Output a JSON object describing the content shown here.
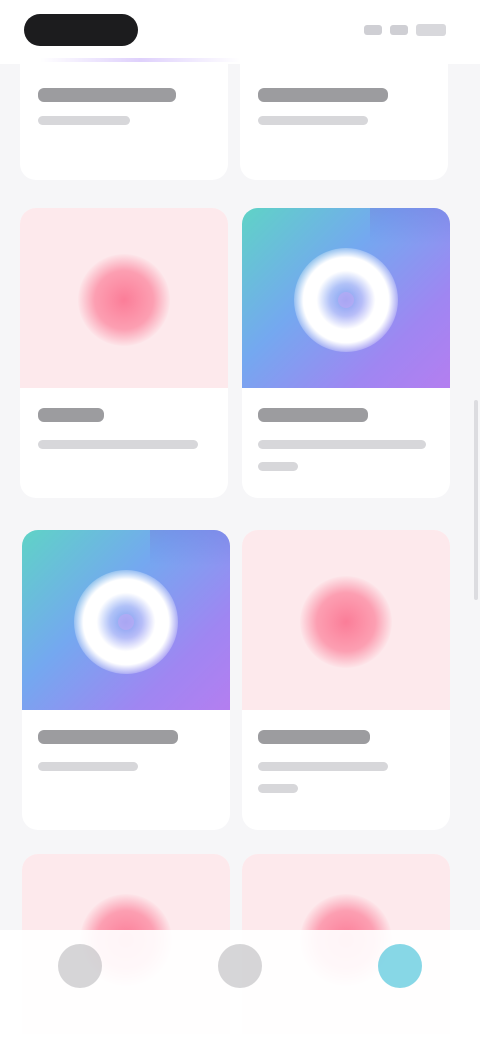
{
  "app": {
    "title": ""
  },
  "status_bar": {
    "time": ""
  },
  "cards": [
    {
      "kind": "text",
      "title": "",
      "subtitle": ""
    },
    {
      "kind": "text",
      "title": "",
      "subtitle": ""
    },
    {
      "kind": "pink",
      "title": "",
      "subtitle": "",
      "icon": "heart-icon"
    },
    {
      "kind": "gradient",
      "title": "",
      "subtitle": "",
      "icon": "record-icon"
    },
    {
      "kind": "gradient",
      "title": "",
      "subtitle": "",
      "icon": "record-icon"
    },
    {
      "kind": "pink",
      "title": "",
      "subtitle": "",
      "icon": "heart-icon"
    },
    {
      "kind": "pink",
      "title": "",
      "subtitle": "",
      "icon": "heart-icon"
    },
    {
      "kind": "pink",
      "title": "",
      "subtitle": "",
      "icon": "heart-icon"
    }
  ],
  "bottom_nav": {
    "items": [
      {
        "label": "",
        "icon": "home-icon"
      },
      {
        "label": "",
        "icon": "explore-icon"
      },
      {
        "label": "",
        "icon": "profile-icon",
        "active": true
      }
    ]
  },
  "colors": {
    "accent": "#5fc9dd",
    "pink_bg": "#fde9ec",
    "pink_icon": "#fb7d98",
    "gradient_start": "#5fd3c6",
    "gradient_end": "#b47ef0"
  }
}
